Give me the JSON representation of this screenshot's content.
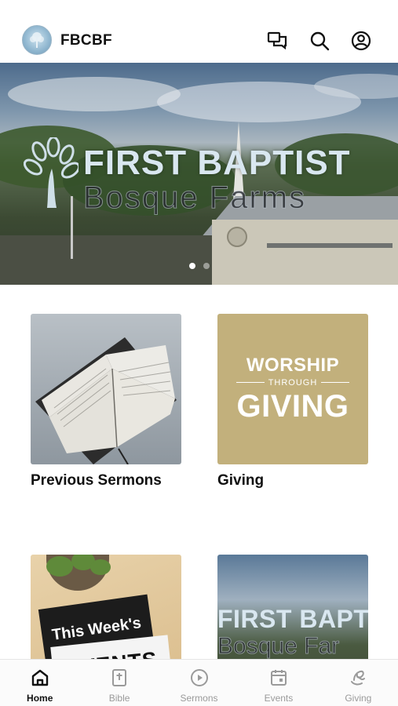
{
  "header": {
    "title": "FBCBF",
    "icons": [
      "chat-icon",
      "search-icon",
      "account-icon"
    ]
  },
  "hero": {
    "title_line1": "FIRST BAPTIST",
    "title_line2": "Bosque Farms",
    "slide_count": 2,
    "active_slide": 1
  },
  "cards": [
    {
      "label": "Previous Sermons",
      "image": "open-bible"
    },
    {
      "label": "Giving",
      "image": "worship-through-giving",
      "image_text": {
        "line1": "WORSHIP",
        "line2": "THROUGH",
        "line3": "GIVING"
      }
    },
    {
      "label": "",
      "image": "this-weeks-events",
      "image_text": {
        "line1": "This Week's",
        "line2": "EVENTS"
      }
    },
    {
      "label": "",
      "image": "first-baptist-church",
      "image_text": {
        "line1": "FIRST BAPT",
        "line2": "Bosque Far"
      }
    }
  ],
  "bottom_nav": {
    "active": "Home",
    "items": [
      {
        "label": "Home",
        "icon": "home-icon"
      },
      {
        "label": "Bible",
        "icon": "bible-icon"
      },
      {
        "label": "Sermons",
        "icon": "play-circle-icon"
      },
      {
        "label": "Events",
        "icon": "calendar-icon"
      },
      {
        "label": "Giving",
        "icon": "giving-icon"
      }
    ]
  },
  "colors": {
    "giving_bg": "#c2b07c",
    "nav_active": "#111111",
    "nav_inactive": "#9a9a9a"
  }
}
